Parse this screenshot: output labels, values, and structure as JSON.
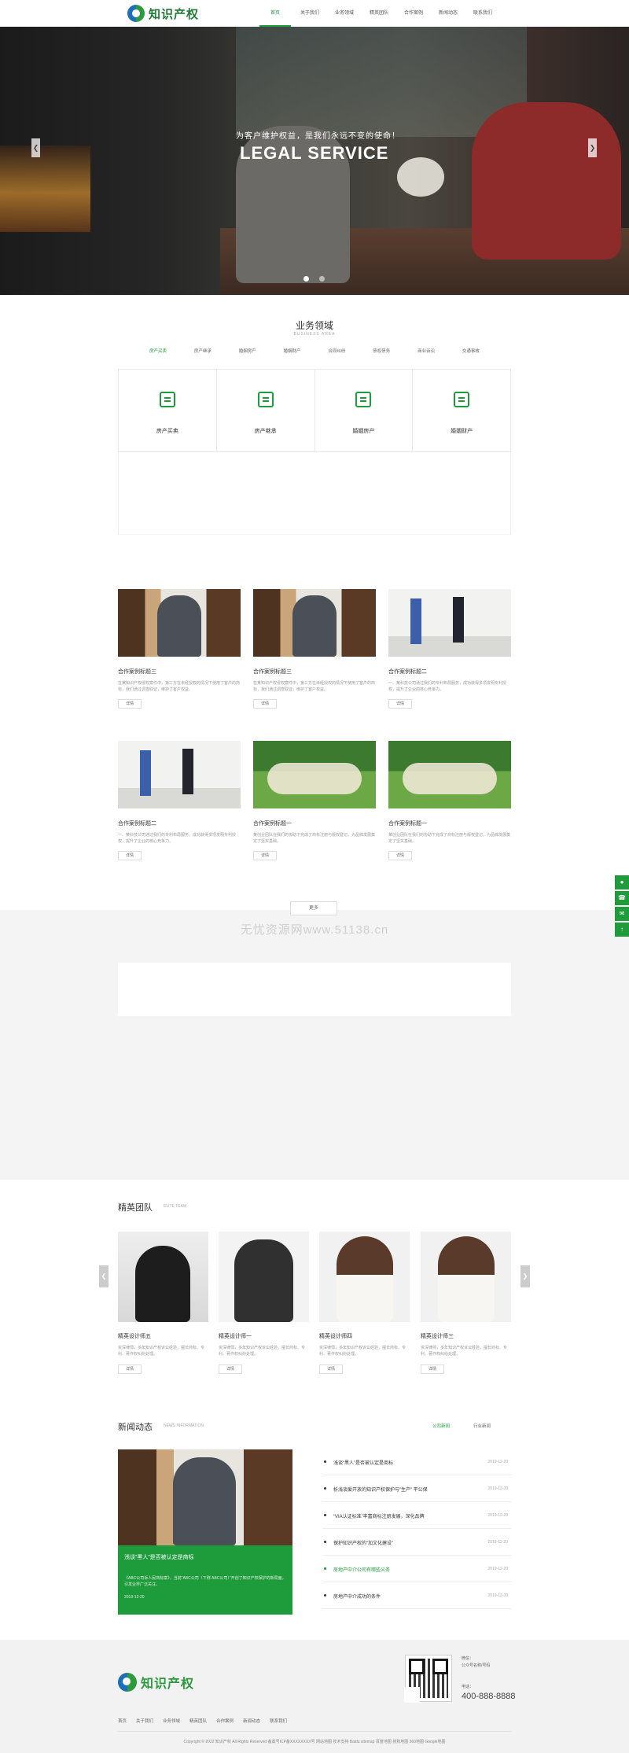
{
  "header": {
    "logo_text": "知识产权",
    "nav": [
      "首页",
      "关于我们",
      "业务领域",
      "精英团队",
      "合作案例",
      "新闻动态",
      "联系我们"
    ],
    "active_index": 0
  },
  "hero": {
    "subtitle": "为客户维护权益，是我们永远不变的使命！",
    "title": "LEGAL SERVICE",
    "dots": 2,
    "active_dot": 0
  },
  "business": {
    "title": "业务领域",
    "subtitle": "BUSINESS AREA",
    "tabs": [
      "房产买卖",
      "房产继承",
      "婚姻房产",
      "婚姻财产",
      "合同纠纷",
      "债权债务",
      "商业诉讼",
      "交通事故"
    ],
    "active_tab": 0,
    "services": [
      {
        "label": "房产买卖",
        "icon": "document-icon"
      },
      {
        "label": "房产继承",
        "icon": "phone-icon"
      },
      {
        "label": "婚姻房产",
        "icon": "printer-icon"
      },
      {
        "label": "婚姻财产",
        "icon": "gift-icon"
      }
    ]
  },
  "cases": {
    "items": [
      {
        "title": "合作案例标题三",
        "desc": "在某知识产权侵权案件中，第三方在未经授权的情况下使用了客户的商标，我们通过调查取证，维护了客户权益。",
        "button": "详情",
        "photo": "library"
      },
      {
        "title": "合作案例标题三",
        "desc": "在某知识产权侵权案件中，第三方在未经授权的情况下使用了客户的商标，我们通过调查取证，维护了客户权益。",
        "button": "详情",
        "photo": "library"
      },
      {
        "title": "合作案例标题二",
        "desc": "一、某科技公司通过我们的专利布局服务，成功获得多项发明专利授权，提升了企业的核心竞争力。",
        "button": "详情",
        "photo": "meeting"
      },
      {
        "title": "合作案例标题二",
        "desc": "一、某科技公司通过我们的专利布局服务，成功获得多项发明专利授权，提升了企业的核心竞争力。",
        "button": "详情",
        "photo": "meeting"
      },
      {
        "title": "合作案例标题一",
        "desc": "某创业团队在我们的协助下完成了商标注册与版权登记，为品牌发展奠定了坚实基础。",
        "button": "详情",
        "photo": "park"
      },
      {
        "title": "合作案例标题一",
        "desc": "某创业团队在我们的协助下完成了商标注册与版权登记，为品牌发展奠定了坚实基础。",
        "button": "详情",
        "photo": "park"
      }
    ],
    "more": "更多"
  },
  "watermark": "无忧资源网www.51138.cn",
  "team": {
    "title": "精英团队",
    "subtitle": "ELITE TEAM",
    "members": [
      {
        "name": "精英设计师五",
        "desc": "资深律师，多年知识产权诉讼经验，擅长商标、专利、著作权纠纷处理。",
        "button": "详情",
        "photo": "man1"
      },
      {
        "name": "精英设计师一",
        "desc": "资深律师，多年知识产权诉讼经验，擅长商标、专利、著作权纠纷处理。",
        "button": "详情",
        "photo": "man2"
      },
      {
        "name": "精英设计师四",
        "desc": "资深律师，多年知识产权诉讼经验，擅长商标、专利、著作权纠纷处理。",
        "button": "详情",
        "photo": "woman"
      },
      {
        "name": "精英设计师三",
        "desc": "资深律师，多年知识产权诉讼经验，擅长商标、专利、著作权纠纷处理。",
        "button": "详情",
        "photo": "woman"
      }
    ]
  },
  "news": {
    "title": "新闻动态",
    "subtitle": "NEWS INFORMATION",
    "tabs": [
      "公司新闻",
      "行业新闻"
    ],
    "active_tab": 0,
    "feature": {
      "title": "浅谈“黑人”是否被认定是商标",
      "desc": "《ABC公司诉人民商标案》，当前“ABC公司（下称 ABC公司）”开创了知识产权保护的新局面，引发业界广泛关注。",
      "date": "2019-12-20"
    },
    "items": [
      {
        "title": "浅谈“黑人”是否被认定是商标",
        "date": "2019-12-20"
      },
      {
        "title": "析浅谈爱开放的知识产权保护与”生产” 平公保",
        "date": "2019-12-20"
      },
      {
        "title": "“VIA认证标准”丰富商标注册发展，深化品牌",
        "date": "2019-12-20"
      },
      {
        "title": "保护知识产权的“加文化建设”",
        "date": "2019-12-20"
      },
      {
        "title": "房地产中介公司有哪些义务",
        "date": "2019-12-20"
      },
      {
        "title": "房地产中介成功的条件",
        "date": "2019-12-20"
      }
    ],
    "active_item": 4
  },
  "footer": {
    "logo_text": "知识产权",
    "contact_label": "微信：",
    "contact_value": "公众号名称/号码",
    "phone_label": "电话：",
    "phone": "400-888-8888",
    "nav": [
      "首页",
      "关于我们",
      "业务领域",
      "精英团队",
      "合作案例",
      "新闻动态",
      "联系我们"
    ],
    "copyright": "Copyright © 2022 知识产权 All Rights Reserved 备案号ICP备XXXXXXXX号 网站地图 技术支持 Baidu sitemap 百度地图 搜狗地图 360地图 Google地图"
  },
  "side_toolbar": [
    "QQ",
    "电话",
    "微信",
    "顶部"
  ],
  "colors": {
    "accent": "#1e9b3a",
    "footer_bg": "#f2f2f2",
    "band_bg": "#f4f4f4"
  }
}
